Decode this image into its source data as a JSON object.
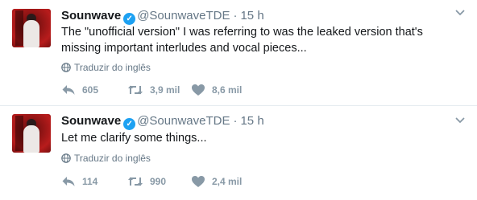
{
  "tweets": [
    {
      "name": "Sounwave",
      "handle": "@SounwaveTDE",
      "separator": "·",
      "time": "15 h",
      "text": "The \"unofficial version\" I was referring to was the leaked version that's missing important interludes and vocal pieces...",
      "translate": "Traduzir do inglês",
      "replies": "605",
      "retweets": "3,9 mil",
      "likes": "8,6 mil"
    },
    {
      "name": "Sounwave",
      "handle": "@SounwaveTDE",
      "separator": "·",
      "time": "15 h",
      "text": "Let me clarify some things...",
      "translate": "Traduzir do inglês",
      "replies": "114",
      "retweets": "990",
      "likes": "2,4 mil"
    }
  ],
  "icons": {
    "verified": "verified-badge-icon",
    "caret": "chevron-down-icon",
    "globe": "globe-icon",
    "reply": "reply-icon",
    "retweet": "retweet-icon",
    "like": "heart-icon"
  },
  "colors": {
    "verified": "#1da1f2",
    "muted": "#657786",
    "action": "#8899a6",
    "background": "#e6ecf0"
  }
}
